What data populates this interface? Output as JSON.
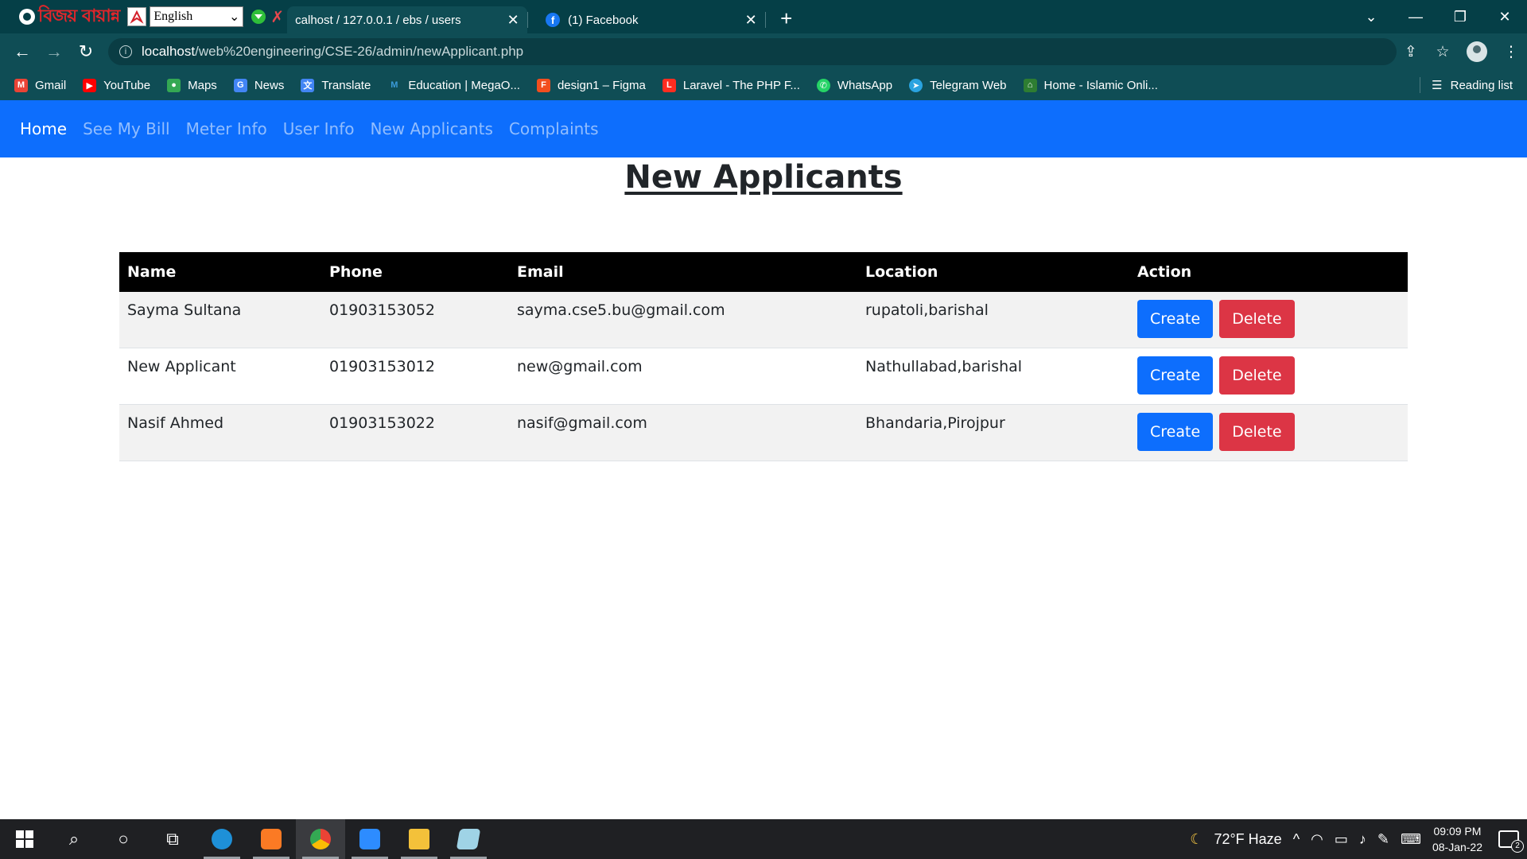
{
  "overlay": {
    "brand": "বিজয় বায়ান্ন",
    "language": "English"
  },
  "tabs": [
    {
      "label": "calhost / 127.0.0.1 / ebs / users",
      "active": true
    },
    {
      "label": "(1) Facebook",
      "active": false
    }
  ],
  "address": {
    "host": "localhost",
    "path": "/web%20engineering/CSE-26/admin/newApplicant.php"
  },
  "bookmarks": [
    {
      "label": "Gmail",
      "icon": "gmail-icon",
      "color": "#ea4335"
    },
    {
      "label": "YouTube",
      "icon": "youtube-icon",
      "color": "#ff0000"
    },
    {
      "label": "Maps",
      "icon": "maps-icon",
      "color": "#34a853"
    },
    {
      "label": "News",
      "icon": "news-icon",
      "color": "#4285f4"
    },
    {
      "label": "Translate",
      "icon": "translate-icon",
      "color": "#4285f4"
    },
    {
      "label": "Education | MegaO...",
      "icon": "megaonline-icon",
      "color": "#3b9ad9"
    },
    {
      "label": "design1 – Figma",
      "icon": "figma-icon",
      "color": "#f24e1e"
    },
    {
      "label": "Laravel - The PHP F...",
      "icon": "laravel-icon",
      "color": "#ff2d20"
    },
    {
      "label": "WhatsApp",
      "icon": "whatsapp-icon",
      "color": "#25d366"
    },
    {
      "label": "Telegram Web",
      "icon": "telegram-icon",
      "color": "#2aa3e0"
    },
    {
      "label": "Home - Islamic Onli...",
      "icon": "islamic-online-icon",
      "color": "#2e7d32"
    }
  ],
  "reading_list": "Reading list",
  "navbar": {
    "links": [
      "Home",
      "See My Bill",
      "Meter Info",
      "User Info",
      "New Applicants",
      "Complaints"
    ],
    "active": "Home"
  },
  "page": {
    "title": "New Applicants"
  },
  "table": {
    "headers": [
      "Name",
      "Phone",
      "Email",
      "Location",
      "Action"
    ],
    "rows": [
      {
        "name": "Sayma Sultana",
        "phone": "01903153052",
        "email": "sayma.cse5.bu@gmail.com",
        "location": "rupatoli,barishal"
      },
      {
        "name": "New Applicant",
        "phone": "01903153012",
        "email": "new@gmail.com",
        "location": "Nathullabad,barishal"
      },
      {
        "name": "Nasif Ahmed",
        "phone": "01903153022",
        "email": "nasif@gmail.com",
        "location": "Bhandaria,Pirojpur"
      }
    ],
    "create_label": "Create",
    "delete_label": "Delete"
  },
  "colors": {
    "navbar": "#0d6efd",
    "create": "#0d6efd",
    "delete": "#dc3545",
    "header": "#000000"
  },
  "taskbar": {
    "weather": "72°F  Haze",
    "time": "09:09 PM",
    "date": "08-Jan-22",
    "notifications": "2"
  }
}
